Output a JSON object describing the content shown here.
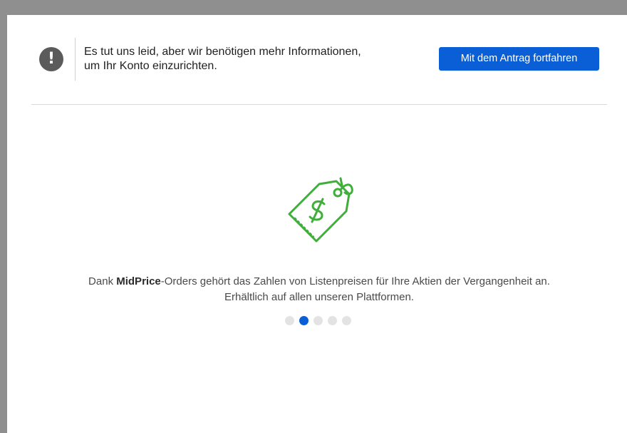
{
  "notice": {
    "icon": "exclamation-icon",
    "icon_glyph": "!",
    "line1": "Es tut uns leid, aber wir benötigen mehr Informationen,",
    "line2": "um Ihr Konto einzurichten.",
    "button_label": "Mit dem Antrag fortfahren"
  },
  "feature": {
    "icon": "price-tag-dollar-icon",
    "text_prefix": "Dank ",
    "text_bold": "MidPrice",
    "text_rest": "-Orders gehört das Zahlen von Listenpreisen für Ihre Aktien der Vergangenheit an.",
    "text_line2": "Erhältlich auf allen unseren Plattformen."
  },
  "carousel": {
    "total": 5,
    "active_index": 1
  },
  "colors": {
    "accent": "#0a5fd6",
    "icon_green": "#3fae3a",
    "notice_icon_bg": "#5b5b5b",
    "chrome_gray": "#8f8f8f"
  }
}
